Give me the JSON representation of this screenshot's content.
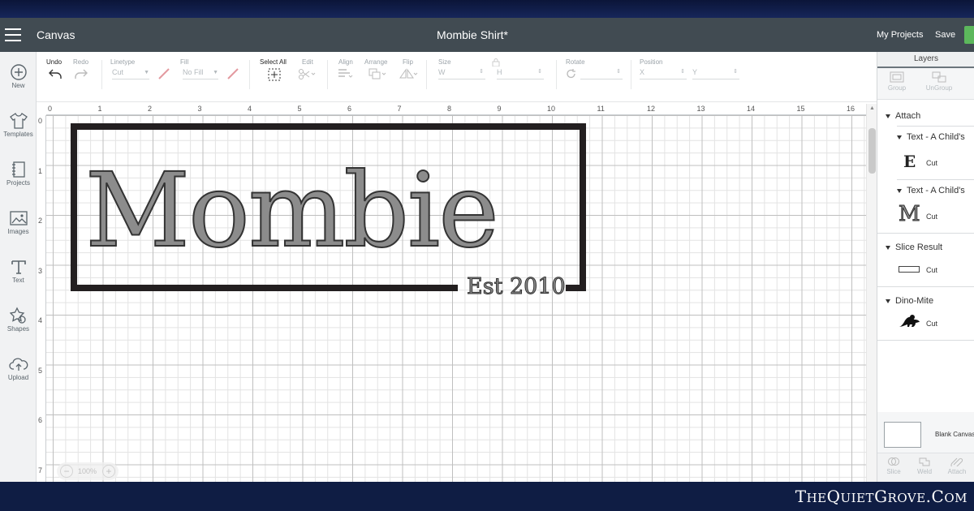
{
  "header": {
    "app_name": "Canvas",
    "doc_title": "Mombie Shirt*",
    "my_projects": "My Projects",
    "save": "Save",
    "accent": "#5cb85c"
  },
  "left_toolbar": [
    {
      "label": "New",
      "icon": "plus-circle-icon"
    },
    {
      "label": "Templates",
      "icon": "shirt-icon"
    },
    {
      "label": "Projects",
      "icon": "projects-icon"
    },
    {
      "label": "Images",
      "icon": "image-icon"
    },
    {
      "label": "Text",
      "icon": "text-icon"
    },
    {
      "label": "Shapes",
      "icon": "shapes-icon"
    },
    {
      "label": "Upload",
      "icon": "upload-icon"
    }
  ],
  "toolbar": {
    "undo": "Undo",
    "redo": "Redo",
    "linetype": "Linetype",
    "linetype_value": "Cut",
    "fill": "Fill",
    "fill_value": "No Fill",
    "select_all": "Select All",
    "edit": "Edit",
    "align": "Align",
    "arrange": "Arrange",
    "flip": "Flip",
    "size": "Size",
    "size_w": "W",
    "size_h": "H",
    "rotate": "Rotate",
    "position": "Position",
    "pos_x": "X",
    "pos_y": "Y"
  },
  "ruler": {
    "top": [
      "0",
      "1",
      "2",
      "3",
      "4",
      "5",
      "6",
      "7",
      "8",
      "9",
      "10",
      "11",
      "12",
      "13",
      "14",
      "15",
      "16"
    ],
    "left": [
      "0",
      "1",
      "2",
      "3",
      "4",
      "5",
      "6",
      "7"
    ]
  },
  "design": {
    "main_text": "Mombie",
    "sub_text": "Est 2010",
    "text_fill": "#8c8c8c",
    "frame_color": "#231f20"
  },
  "zoom": {
    "minus": "−",
    "value": "100%",
    "plus": "+"
  },
  "layers": {
    "title": "Layers",
    "group": "Group",
    "ungroup": "UnGroup",
    "items": [
      {
        "label": "Attach"
      },
      {
        "label": "Text - A Child's",
        "operation": "Cut",
        "preview": "E"
      },
      {
        "label": "Text - A Child's",
        "operation": "Cut",
        "preview": "M"
      },
      {
        "label": "Slice Result",
        "operation": "Cut"
      },
      {
        "label": "Dino-Mite",
        "operation": "Cut"
      }
    ],
    "blank_canvas": "Blank Canvas",
    "slice": "Slice",
    "weld": "Weld",
    "attach": "Attach"
  },
  "watermark": {
    "t1": "T",
    "r1": "HE",
    "t2": "Q",
    "r2": "UIET",
    "t3": "G",
    "r3": "ROVE",
    "t4": ".C",
    "r4": "OM"
  }
}
